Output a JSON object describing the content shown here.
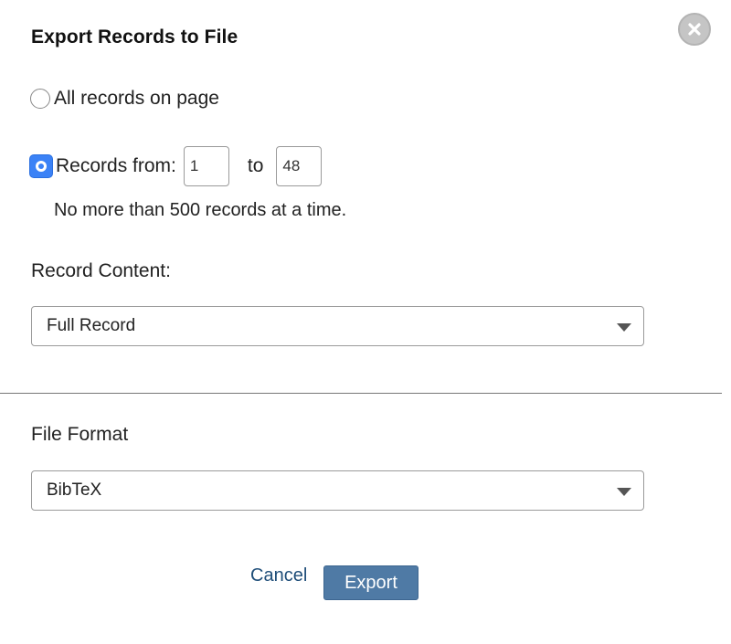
{
  "dialog": {
    "title": "Export Records to File",
    "close_icon": "close-icon"
  },
  "range": {
    "all_label": "All records on page",
    "range_label": "Records from:",
    "selected": "range",
    "from_value": "1",
    "to_label": "to",
    "to_value": "48",
    "hint": "No more than 500 records at a time."
  },
  "content": {
    "label": "Record Content:",
    "selected": "Full Record"
  },
  "format": {
    "label": "File Format",
    "selected": "BibTeX"
  },
  "actions": {
    "cancel_label": "Cancel",
    "export_label": "Export"
  },
  "colors": {
    "accent": "#3b82f6",
    "export_button": "#4f7aa5",
    "link": "#1f4e79",
    "close_button": "#c5c5c5"
  }
}
